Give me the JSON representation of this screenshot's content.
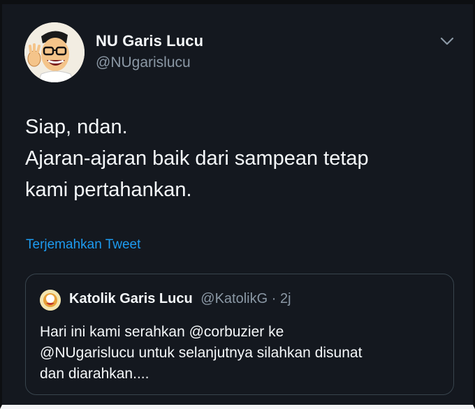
{
  "tweet": {
    "author": {
      "display_name": "NU Garis Lucu",
      "handle": "@NUgarislucu",
      "avatar_icon": "cartoon-man-waving-avatar"
    },
    "menu_icon": "chevron-down-icon",
    "text_lines": [
      "Siap, ndan.",
      "Ajaran-ajaran baik dari sampean tetap",
      "kami pertahankan."
    ],
    "translate_label": "Terjemahkan Tweet",
    "colors": {
      "background": "#14181f",
      "link": "#1d9bf0",
      "secondary_text": "#8b98a5",
      "border": "#38444d"
    }
  },
  "quoted_tweet": {
    "author": {
      "display_name": "Katolik Garis Lucu",
      "handle": "@KatolikG",
      "separator": "·",
      "time": "2j",
      "avatar_icon": "katolik-logo-avatar"
    },
    "text_lines": [
      "Hari ini kami serahkan @corbuzier ke",
      "@NUgarislucu untuk selanjutnya silahkan disunat",
      "dan diarahkan...."
    ]
  }
}
